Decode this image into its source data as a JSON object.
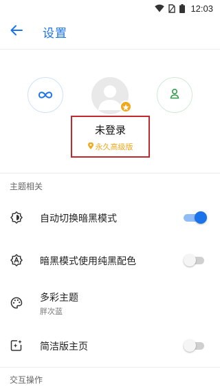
{
  "status_bar": {
    "time": "12:03",
    "icons": [
      "wifi-icon",
      "no-sim-icon",
      "battery-icon"
    ]
  },
  "app_bar": {
    "title": "设置",
    "back_icon": "arrow-back-icon",
    "accent_color": "#1a73e8"
  },
  "profile": {
    "left_icon": "infinity-icon",
    "right_icon": "person-icon",
    "avatar_icon": "default-avatar-icon",
    "badge_icon": "star-icon",
    "name": "未登录",
    "tag": "永久高级版",
    "tag_icon": "location-pin-icon",
    "tag_color": "#f2a81d",
    "highlight_color": "#c1272d"
  },
  "sections": {
    "theme": {
      "title": "主题相关",
      "items": [
        {
          "label": "自动切换暗黑模式",
          "icon": "brightness-auto-icon",
          "toggle": true
        },
        {
          "label": "暗黑模式使用纯黑配色",
          "icon": "font-a-icon",
          "toggle": false
        },
        {
          "label": "多彩主题",
          "subtitle": "胖次蓝",
          "icon": "palette-icon"
        },
        {
          "label": "简洁版主页",
          "icon": "home-sparkle-icon",
          "toggle": false
        }
      ]
    },
    "interaction": {
      "title": "交互操作"
    }
  }
}
